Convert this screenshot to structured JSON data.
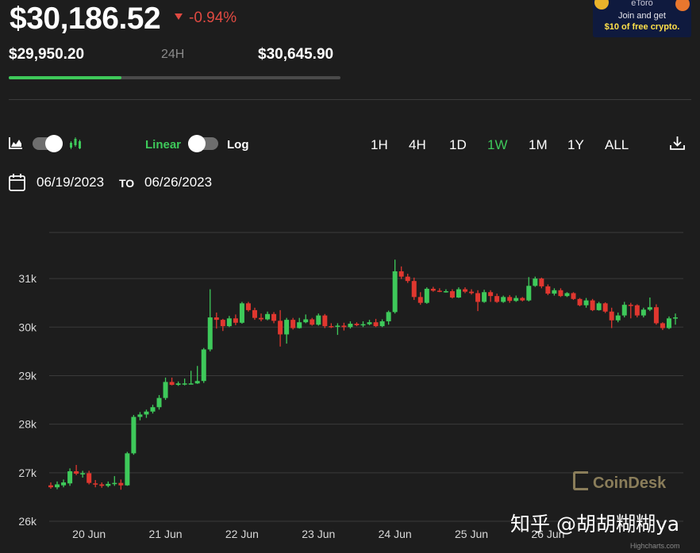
{
  "header": {
    "price": "$30,186.52",
    "change": "-0.94%",
    "low": "$29,950.20",
    "period": "24H",
    "high": "$30,645.90",
    "range_position": 0.34
  },
  "ad": {
    "line1": "eToro",
    "line2": "Join and get",
    "line3": "$10 of free crypto."
  },
  "controls": {
    "linear_label": "Linear",
    "log_label": "Log",
    "timeframes": [
      "1H",
      "4H",
      "1D",
      "1W",
      "1M",
      "1Y",
      "ALL"
    ],
    "active_timeframe": "1W",
    "from_date": "06/19/2023",
    "to_label": "TO",
    "to_date": "06/26/2023"
  },
  "colors": {
    "up": "#3ec95a",
    "down": "#e0372f",
    "accent": "#3ec95a"
  },
  "icons": {
    "chart_type": "area-chart-icon",
    "candles": "candlestick-icon",
    "calendar": "calendar-icon",
    "download": "download-icon"
  },
  "chart_data": {
    "type": "candlestick",
    "y_ticks": [
      "26k",
      "27k",
      "28k",
      "29k",
      "30k",
      "31k"
    ],
    "x_ticks": [
      "20 Jun",
      "21 Jun",
      "22 Jun",
      "23 Jun",
      "24 Jun",
      "25 Jun",
      "26 Jun"
    ],
    "ylim": [
      26000,
      31950
    ],
    "grid": true,
    "series": [
      [
        26740,
        26700,
        26800,
        26670
      ],
      [
        26700,
        26760,
        26820,
        26660
      ],
      [
        26740,
        26800,
        26860,
        26700
      ],
      [
        26780,
        27030,
        27090,
        26730
      ],
      [
        27030,
        26980,
        27160,
        26950
      ],
      [
        26980,
        26990,
        27040,
        26900
      ],
      [
        26990,
        26790,
        27040,
        26760
      ],
      [
        26780,
        26760,
        26850,
        26700
      ],
      [
        26760,
        26730,
        26800,
        26690
      ],
      [
        26730,
        26770,
        26820,
        26700
      ],
      [
        26770,
        26790,
        26930,
        26730
      ],
      [
        26790,
        26740,
        26860,
        26650
      ],
      [
        26740,
        27400,
        27430,
        26730
      ],
      [
        27400,
        28150,
        28190,
        27370
      ],
      [
        28150,
        28200,
        28250,
        28080
      ],
      [
        28200,
        28260,
        28300,
        28130
      ],
      [
        28260,
        28350,
        28400,
        28220
      ],
      [
        28350,
        28540,
        28600,
        28300
      ],
      [
        28540,
        28870,
        28960,
        28500
      ],
      [
        28870,
        28810,
        28960,
        28800
      ],
      [
        28810,
        28840,
        28880,
        28790
      ],
      [
        28840,
        28840,
        28940,
        28800
      ],
      [
        28840,
        28840,
        29100,
        28830
      ],
      [
        28840,
        28890,
        29200,
        28830
      ],
      [
        28890,
        29540,
        29570,
        28850
      ],
      [
        29540,
        30200,
        30780,
        29500
      ],
      [
        30200,
        30150,
        30300,
        29970
      ],
      [
        30150,
        30020,
        30170,
        29920
      ],
      [
        30020,
        30180,
        30230,
        30000
      ],
      [
        30180,
        30090,
        30260,
        30040
      ],
      [
        30090,
        30490,
        30520,
        30070
      ],
      [
        30490,
        30350,
        30520,
        30320
      ],
      [
        30350,
        30190,
        30400,
        30150
      ],
      [
        30190,
        30160,
        30280,
        30120
      ],
      [
        30160,
        30270,
        30320,
        30140
      ],
      [
        30270,
        30130,
        30310,
        30080
      ],
      [
        30130,
        29850,
        30350,
        29600
      ],
      [
        29850,
        30150,
        30190,
        29660
      ],
      [
        30150,
        29980,
        30190,
        29950
      ],
      [
        29980,
        30100,
        30190,
        29970
      ],
      [
        30100,
        30160,
        30260,
        30080
      ],
      [
        30160,
        30050,
        30190,
        30030
      ],
      [
        30050,
        30240,
        30280,
        30030
      ],
      [
        30240,
        30020,
        30270,
        29980
      ],
      [
        30020,
        30010,
        30080,
        29980
      ],
      [
        30010,
        30030,
        30080,
        29840
      ],
      [
        30030,
        30000,
        30090,
        29930
      ],
      [
        30000,
        30070,
        30120,
        29970
      ],
      [
        30070,
        30040,
        30100,
        30020
      ],
      [
        30040,
        30060,
        30120,
        30000
      ],
      [
        30060,
        30100,
        30150,
        30040
      ],
      [
        30100,
        30020,
        30170,
        30000
      ],
      [
        30020,
        30120,
        30160,
        30000
      ],
      [
        30120,
        30310,
        30340,
        30050
      ],
      [
        30310,
        31150,
        31390,
        30280
      ],
      [
        31150,
        31040,
        31250,
        30990
      ],
      [
        31040,
        30950,
        31100,
        30910
      ],
      [
        30950,
        30620,
        31020,
        30560
      ],
      [
        30620,
        30500,
        30720,
        30460
      ],
      [
        30500,
        30790,
        30820,
        30480
      ],
      [
        30790,
        30750,
        30830,
        30730
      ],
      [
        30750,
        30740,
        30800,
        30720
      ],
      [
        30740,
        30740,
        30780,
        30710
      ],
      [
        30740,
        30610,
        30780,
        30590
      ],
      [
        30610,
        30780,
        30820,
        30600
      ],
      [
        30780,
        30730,
        30820,
        30700
      ],
      [
        30730,
        30700,
        30780,
        30670
      ],
      [
        30700,
        30520,
        30760,
        30330
      ],
      [
        30520,
        30720,
        30770,
        30500
      ],
      [
        30720,
        30640,
        30760,
        30520
      ],
      [
        30640,
        30520,
        30690,
        30500
      ],
      [
        30520,
        30620,
        30650,
        30500
      ],
      [
        30620,
        30540,
        30660,
        30500
      ],
      [
        30540,
        30600,
        30650,
        30520
      ],
      [
        30600,
        30550,
        30620,
        30530
      ],
      [
        30550,
        30850,
        31030,
        30530
      ],
      [
        30850,
        31000,
        31040,
        30830
      ],
      [
        31000,
        30840,
        31020,
        30800
      ],
      [
        30840,
        30690,
        30880,
        30660
      ],
      [
        30690,
        30760,
        30800,
        30650
      ],
      [
        30760,
        30640,
        30800,
        30620
      ],
      [
        30640,
        30700,
        30720,
        30620
      ],
      [
        30700,
        30580,
        30720,
        30560
      ],
      [
        30580,
        30450,
        30600,
        30430
      ],
      [
        30450,
        30550,
        30600,
        30400
      ],
      [
        30550,
        30350,
        30580,
        30330
      ],
      [
        30350,
        30490,
        30520,
        30340
      ],
      [
        30490,
        30320,
        30510,
        30290
      ],
      [
        30320,
        30140,
        30400,
        29980
      ],
      [
        30140,
        30240,
        30300,
        30100
      ],
      [
        30240,
        30460,
        30520,
        30200
      ],
      [
        30460,
        30450,
        30500,
        30180
      ],
      [
        30450,
        30240,
        30470,
        30200
      ],
      [
        30240,
        30360,
        30400,
        30200
      ],
      [
        30360,
        30410,
        30610,
        30330
      ],
      [
        30410,
        30080,
        30470,
        30050
      ],
      [
        30080,
        29980,
        30100,
        29940
      ],
      [
        29980,
        30180,
        30220,
        29960
      ],
      [
        30180,
        30200,
        30280,
        30050
      ]
    ]
  },
  "watermark": "CoinDesk",
  "overlay_text": "知乎 @胡胡糊糊ya",
  "credit": "Highcharts.com"
}
